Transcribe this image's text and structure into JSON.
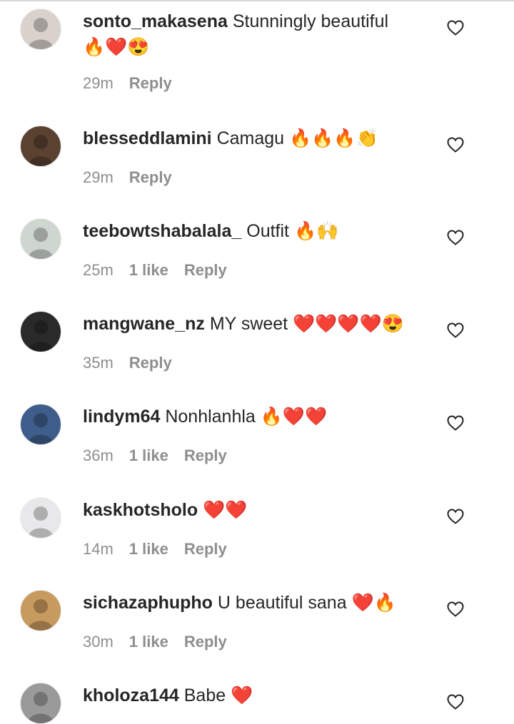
{
  "comments": [
    {
      "username": "sonto_makasena",
      "text": "Stunningly beautiful",
      "emojis": [
        "🔥",
        "❤️",
        "😍"
      ],
      "time": "29m",
      "likes": "",
      "reply": "Reply",
      "avatar_color": "#d9d2cc"
    },
    {
      "username": "blesseddlamini",
      "text": "Camagu",
      "emojis": [
        "🔥",
        "🔥",
        "🔥",
        "👏"
      ],
      "time": "29m",
      "likes": "",
      "reply": "Reply",
      "avatar_color": "#5a4130"
    },
    {
      "username": "teebowtshabalala_",
      "text": "Outfit",
      "emojis": [
        "🔥",
        "🙌"
      ],
      "time": "25m",
      "likes": "1 like",
      "reply": "Reply",
      "avatar_color": "#cfd6d0"
    },
    {
      "username": "mangwane_nz",
      "text": "MY sweet",
      "emojis": [
        "❤️",
        "❤️",
        "❤️",
        "❤️",
        "😍"
      ],
      "time": "35m",
      "likes": "",
      "reply": "Reply",
      "avatar_color": "#2a2a2a"
    },
    {
      "username": "lindym64",
      "text": "Nonhlanhla",
      "emojis": [
        "🔥",
        "❤️",
        "❤️"
      ],
      "time": "36m",
      "likes": "1 like",
      "reply": "Reply",
      "avatar_color": "#3f5d8a"
    },
    {
      "username": "kaskhotsholo",
      "text": "",
      "emojis": [
        "❤️",
        "❤️"
      ],
      "time": "14m",
      "likes": "1 like",
      "reply": "Reply",
      "avatar_color": "#e8e8ea"
    },
    {
      "username": "sichazaphupho",
      "text": "U beautiful sana",
      "emojis": [
        "❤️",
        "🔥"
      ],
      "time": "30m",
      "likes": "1 like",
      "reply": "Reply",
      "avatar_color": "#c79a5e"
    },
    {
      "username": "kholoza144",
      "text": "Babe",
      "emojis": [
        "❤️"
      ],
      "time": "",
      "likes": "",
      "reply": "",
      "avatar_color": "#9a9a9a"
    }
  ],
  "icons": {
    "avatar": "profile-picture",
    "like": "heart-outline-icon"
  },
  "colors": {
    "text": "#262626",
    "meta": "#8e8e8e",
    "heart_stroke": "#262626"
  }
}
